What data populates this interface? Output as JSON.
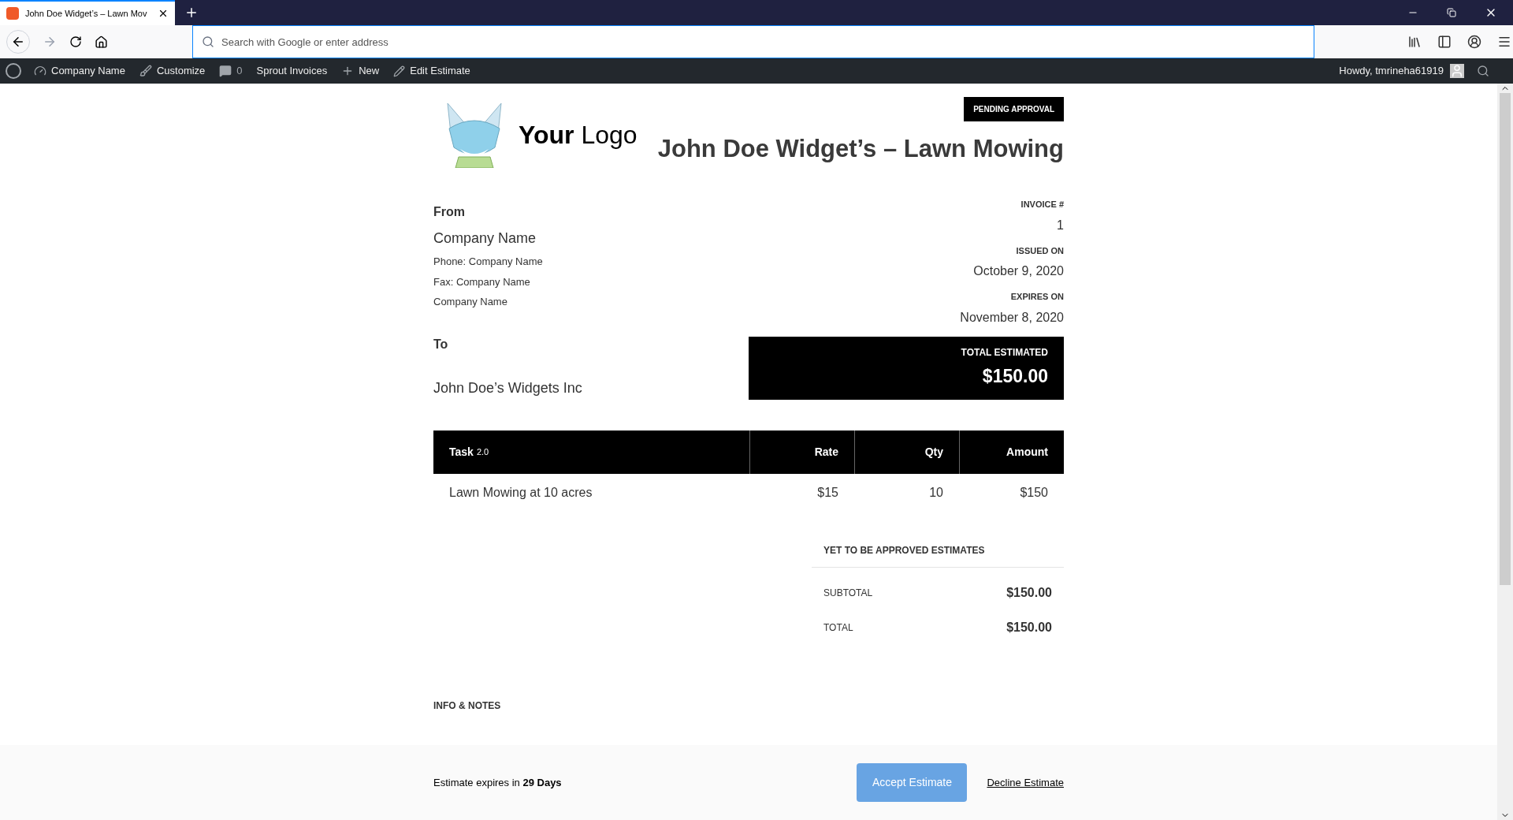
{
  "browser": {
    "tab_title": "John Doe Widget’s – Lawn Mov",
    "address_placeholder": "Search with Google or enter address"
  },
  "admin_bar": {
    "items": [
      {
        "kind": "site",
        "label": "Company Name"
      },
      {
        "kind": "customize",
        "label": "Customize"
      },
      {
        "kind": "comments",
        "label": "0"
      },
      {
        "kind": "plain",
        "label": "Sprout Invoices"
      },
      {
        "kind": "new",
        "label": "New"
      },
      {
        "kind": "edit",
        "label": "Edit Estimate"
      }
    ],
    "greeting": "Howdy, tmrineha61919"
  },
  "header": {
    "logo_bold": "Your",
    "logo_light": "Logo",
    "status_badge": "PENDING APPROVAL",
    "title": "John Doe Widget’s – Lawn Mowing"
  },
  "from": {
    "heading": "From",
    "name": "Company Name",
    "lines": [
      "Phone: Company Name",
      "Fax: Company Name",
      "Company Name"
    ]
  },
  "to": {
    "heading": "To",
    "name": "John Doe’s Widgets Inc"
  },
  "meta": [
    {
      "label": "INVOICE #",
      "value": "1"
    },
    {
      "label": "ISSUED ON",
      "value": "October 9, 2020"
    },
    {
      "label": "EXPIRES ON",
      "value": "November 8, 2020"
    }
  ],
  "total_box": {
    "label": "TOTAL ESTIMATED",
    "value": "$150.00"
  },
  "table": {
    "columns": [
      "Task",
      "Rate",
      "Qty",
      "Amount"
    ],
    "task_version": "2.0",
    "rows": [
      [
        "Lawn Mowing at 10 acres",
        "$15",
        "10",
        "$150"
      ]
    ]
  },
  "totals": {
    "title": "YET TO BE APPROVED ESTIMATES",
    "rows": [
      {
        "label": "SUBTOTAL",
        "value": "$150.00"
      },
      {
        "label": "TOTAL",
        "value": "$150.00"
      }
    ]
  },
  "notes": {
    "heading": "INFO & NOTES"
  },
  "footer": {
    "expires_text": "Estimate expires in **29 Days**",
    "accept": "Accept Estimate",
    "decline": "Decline Estimate"
  }
}
